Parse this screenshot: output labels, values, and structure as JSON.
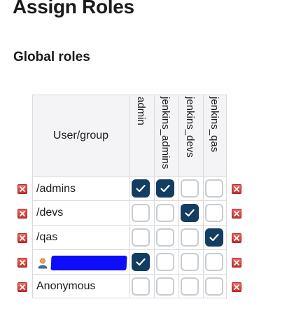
{
  "page": {
    "title": "Assign Roles"
  },
  "section": {
    "title": "Global roles"
  },
  "table": {
    "user_header": "User/group",
    "roles": [
      "admin",
      "jenkins_admins",
      "jenkins_devs",
      "jenkins_qas"
    ],
    "rows": [
      {
        "name": "/admins",
        "checked": [
          true,
          true,
          false,
          false
        ]
      },
      {
        "name": "/devs",
        "checked": [
          false,
          false,
          true,
          false
        ]
      },
      {
        "name": "/qas",
        "checked": [
          false,
          false,
          false,
          true
        ]
      },
      {
        "name": "",
        "redacted": true,
        "icon": "user-icon",
        "checked": [
          true,
          false,
          false,
          false
        ]
      },
      {
        "name": "Anonymous",
        "checked": [
          false,
          false,
          false,
          false
        ]
      }
    ]
  },
  "icons": {
    "delete": "delete-x-icon",
    "checkmark": "checkmark-icon",
    "user": "user-icon"
  },
  "colors": {
    "checkbox_checked": "#133d61",
    "checkbox_border": "#c7ccd3",
    "header_bg": "#f4f4f6",
    "delete_icon": "#d9534f",
    "redaction": "#0d0dfa"
  }
}
